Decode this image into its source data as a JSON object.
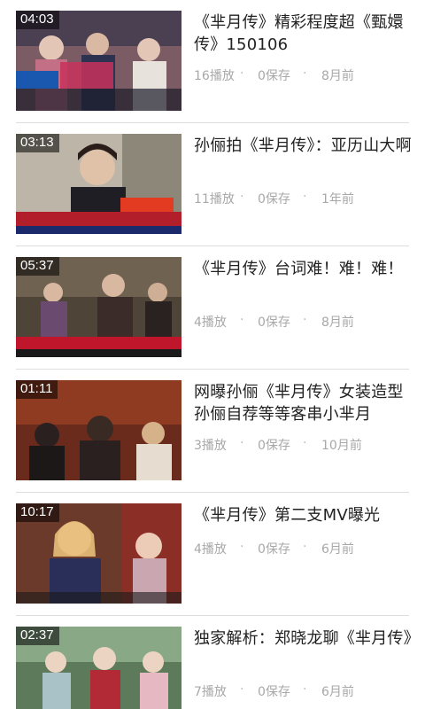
{
  "videos": [
    {
      "duration": "04:03",
      "title": "《芈月传》精彩程度超《甄嬛传》150106",
      "plays": "16播放",
      "saves": "0保存",
      "age": "8月前",
      "thumb_colors": [
        "#8a4a5a",
        "#c88fa0",
        "#2b3350",
        "#d9c0b0"
      ]
    },
    {
      "duration": "03:13",
      "title": "孙俪拍《芈月传》：亚历山大啊",
      "plays": "11播放",
      "saves": "0保存",
      "age": "1年前",
      "thumb_colors": [
        "#c9c2b4",
        "#8b8478",
        "#1e1e24",
        "#b21f2a"
      ]
    },
    {
      "duration": "05:37",
      "title": "《芈月传》台词难！难！难！",
      "plays": "4播放",
      "saves": "0保存",
      "age": "8月前",
      "thumb_colors": [
        "#5a4a3a",
        "#8a7a66",
        "#3b2c2a",
        "#c0162b"
      ]
    },
    {
      "duration": "01:11",
      "title": "网曝孙俪《芈月传》女装造型 孙俪自荐等等客串小芈月",
      "plays": "3播放",
      "saves": "0保存",
      "age": "10月前",
      "thumb_colors": [
        "#7a2f1f",
        "#a3492b",
        "#2a2020",
        "#d6b28a"
      ]
    },
    {
      "duration": "10:17",
      "title": "《芈月传》第二支MV曝光",
      "plays": "4播放",
      "saves": "0保存",
      "age": "6月前",
      "thumb_colors": [
        "#6b3a2a",
        "#b0452f",
        "#2a2f5a",
        "#e0b8a0"
      ]
    },
    {
      "duration": "02:37",
      "title": "独家解析：郑晓龙聊《芈月传》",
      "plays": "7播放",
      "saves": "0保存",
      "age": "6月前",
      "thumb_colors": [
        "#5d7a5a",
        "#a8c2a0",
        "#b22a35",
        "#e5d0c0"
      ]
    }
  ],
  "separator": "·"
}
